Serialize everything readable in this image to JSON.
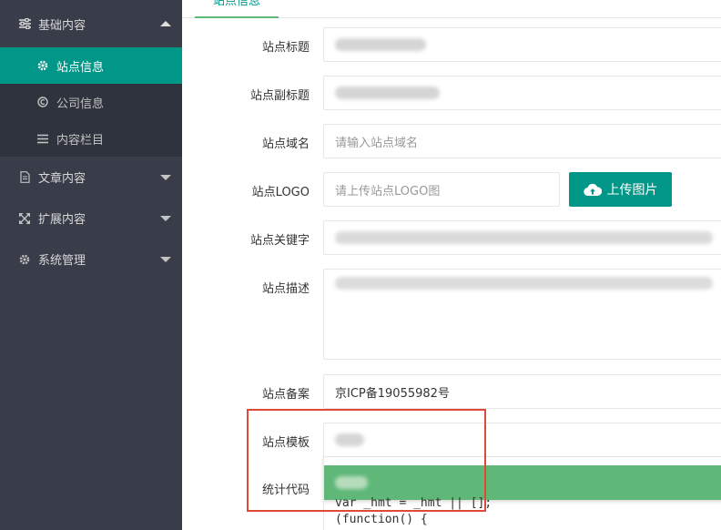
{
  "sidebar": {
    "groups": [
      {
        "label": "基础内容",
        "icon": "sliders-icon",
        "expanded": true
      },
      {
        "label": "文章内容",
        "icon": "document-icon",
        "expanded": false
      },
      {
        "label": "扩展内容",
        "icon": "expand-icon",
        "expanded": false
      },
      {
        "label": "系统管理",
        "icon": "gear-icon",
        "expanded": false
      }
    ],
    "sub_items": [
      {
        "label": "站点信息",
        "icon": "gear-icon",
        "active": true
      },
      {
        "label": "公司信息",
        "icon": "copyright-icon",
        "active": false
      },
      {
        "label": "内容栏目",
        "icon": "menu-icon",
        "active": false
      }
    ]
  },
  "main": {
    "tab_label": "站点信息",
    "fields": {
      "site_title": {
        "label": "站点标题"
      },
      "site_subtitle": {
        "label": "站点副标题"
      },
      "site_domain": {
        "label": "站点域名",
        "placeholder": "请输入站点域名"
      },
      "site_logo": {
        "label": "站点LOGO",
        "placeholder": "请上传站点LOGO图"
      },
      "upload_button": "上传图片",
      "site_keywords": {
        "label": "站点关键字"
      },
      "site_description": {
        "label": "站点描述"
      },
      "site_icp": {
        "label": "站点备案",
        "value": "京ICP备19055982号"
      },
      "site_template": {
        "label": "站点模板"
      },
      "stats_code": {
        "label": "统计代码",
        "code_lines": [
          "var _hmt = _hmt || [];",
          "(function() {"
        ]
      }
    }
  },
  "colors": {
    "sidebar_bg": "#393d49",
    "active": "#009688",
    "option_highlight": "#5FB878",
    "annotation": "#e0483a"
  }
}
